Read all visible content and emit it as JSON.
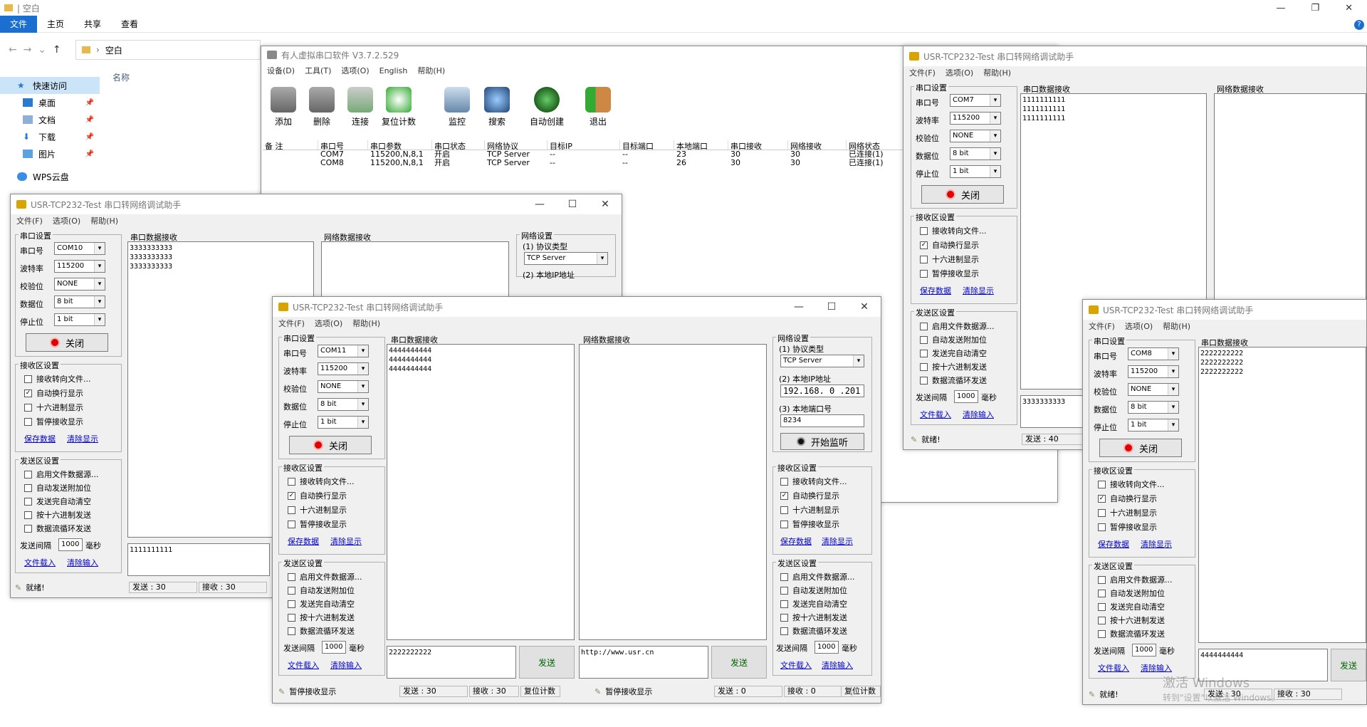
{
  "explorer": {
    "title": "| 空白",
    "ribbon_tabs": [
      "文件",
      "主页",
      "共享",
      "查看"
    ],
    "address": "空白",
    "column_name": "名称",
    "nav": [
      {
        "label": "快速访问",
        "icon": "star-icon"
      },
      {
        "label": "桌面",
        "icon": "desktop-icon"
      },
      {
        "label": "文档",
        "icon": "document-icon"
      },
      {
        "label": "下载",
        "icon": "download-icon"
      },
      {
        "label": "图片",
        "icon": "picture-icon"
      },
      {
        "label": "WPS云盘",
        "icon": "cloud-icon"
      }
    ]
  },
  "virtual": {
    "title": "有人虚拟串口软件 V3.7.2.529",
    "menu": [
      "设备(D)",
      "工具(T)",
      "选项(O)",
      "English",
      "帮助(H)"
    ],
    "tools": [
      "添加",
      "删除",
      "连接",
      "复位计数",
      "监控",
      "搜索",
      "自动创建",
      "退出"
    ],
    "columns": [
      "备 注",
      "串口号",
      "串口参数",
      "串口状态",
      "网络协议",
      "目标IP",
      "目标端口",
      "本地端口",
      "串口接收",
      "网络接收",
      "网络状态"
    ],
    "rows": [
      [
        "",
        "COM7",
        "115200,N,8,1",
        "开启",
        "TCP Server",
        "--",
        "--",
        "23",
        "30",
        "30",
        "已连接(1)"
      ],
      [
        "",
        "COM8",
        "115200,N,8,1",
        "开启",
        "TCP Server",
        "--",
        "--",
        "26",
        "30",
        "30",
        "已连接(1)"
      ]
    ]
  },
  "common": {
    "app_title": "USR-TCP232-Test 串口转网络调试助手",
    "menu": [
      "文件(F)",
      "选项(O)",
      "帮助(H)"
    ],
    "serial_settings": "串口设置",
    "port_label": "串口号",
    "baud_label": "波特率",
    "parity_label": "校验位",
    "databits_label": "数据位",
    "stopbits_label": "停止位",
    "baud": "115200",
    "parity": "NONE",
    "databits": "8 bit",
    "stopbits": "1 bit",
    "close_btn": "关闭",
    "recv_settings": "接收区设置",
    "recv_opts": [
      "接收转向文件...",
      "自动换行显示",
      "十六进制显示",
      "暂停接收显示"
    ],
    "save_data": "保存数据",
    "clear_display": "清除显示",
    "send_settings": "发送区设置",
    "send_opts": [
      "启用文件数据源...",
      "自动发送附加位",
      "发送完自动清空",
      "按十六进制发送",
      "数据流循环发送"
    ],
    "send_interval": "发送间隔",
    "interval_val": "1000",
    "ms": "毫秒",
    "file_load": "文件载入",
    "clear_input": "清除输入",
    "serial_recv": "串口数据接收",
    "net_recv": "网络数据接收",
    "net_settings": "网络设置",
    "proto_label": "(1) 协议类型",
    "proto": "TCP Server",
    "ip_label": "(2) 本地IP地址",
    "ip": "192.168. 0 .201",
    "port_num_label": "(3) 本地端口号",
    "send": "发送",
    "start_listen": "开始监听",
    "ready": "就绪!",
    "pause_recv": "暂停接收显示",
    "reset_count": "复位计数",
    "url": "http://www.usr.cn"
  },
  "w10": {
    "com": "COM10",
    "recv": "3333333333\n3333333333\n3333333333",
    "send_text": "1111111111",
    "sent": "发送 : 30",
    "recvd": "接收 : 30"
  },
  "w7": {
    "com": "COM7",
    "recv": "1111111111\n1111111111\n1111111111",
    "send_text": "3333333333",
    "sent": "发送 : 40"
  },
  "w11": {
    "com": "COM11",
    "recv": "4444444444\n4444444444\n4444444444",
    "send_text": "2222222222",
    "sent": "发送 : 30",
    "recvd": "接收 : 30",
    "port": "8234",
    "net_sent": "发送 : 0",
    "net_recvd": "接收 : 0"
  },
  "w8": {
    "com": "COM8",
    "recv": "2222222222\n2222222222\n2222222222",
    "send_text": "4444444444",
    "sent": "发送 : 30",
    "recvd": "接收 : 30",
    "watermark1": "激活 Windows",
    "watermark2": "转到\"设置\"以激活 Windows。"
  }
}
